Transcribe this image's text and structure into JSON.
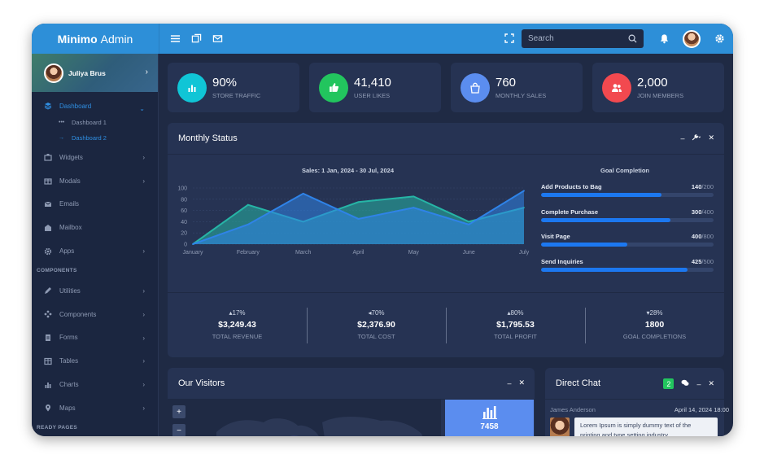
{
  "brand": {
    "bold": "Minimo",
    "rest": "Admin"
  },
  "search": {
    "placeholder": "Search"
  },
  "sidebar": {
    "user_name": "Juliya Brus",
    "items": [
      {
        "label": "Dashboard",
        "icon": "layers-icon"
      },
      {
        "label": "Widgets",
        "icon": "widgets-icon"
      },
      {
        "label": "Modals",
        "icon": "gift-icon"
      },
      {
        "label": "Emails",
        "icon": "email-icon"
      },
      {
        "label": "Mailbox",
        "icon": "mailbox-icon"
      },
      {
        "label": "Apps",
        "icon": "gear-icon"
      },
      {
        "label": "Utilities",
        "icon": "pencil-icon"
      },
      {
        "label": "Components",
        "icon": "components-icon"
      },
      {
        "label": "Forms",
        "icon": "document-icon"
      },
      {
        "label": "Tables",
        "icon": "table-icon"
      },
      {
        "label": "Charts",
        "icon": "bar-chart-icon"
      },
      {
        "label": "Maps",
        "icon": "map-pin-icon"
      }
    ],
    "subitems": [
      {
        "label": "Dashboard 1"
      },
      {
        "label": "Dashboard 2"
      }
    ],
    "sections": [
      "COMPONENTS",
      "READY PAGES"
    ]
  },
  "stats": [
    {
      "value": "90%",
      "label": "STORE TRAFFIC",
      "color": "#10c5d6",
      "icon": "bar-chart-icon"
    },
    {
      "value": "41,410",
      "label": "USER LIKES",
      "color": "#22c55e",
      "icon": "thumbs-up-icon"
    },
    {
      "value": "760",
      "label": "MONTHLY SALES",
      "color": "#5b8def",
      "icon": "shopping-bag-icon"
    },
    {
      "value": "2,000",
      "label": "JOIN MEMBERS",
      "color": "#f2494f",
      "icon": "users-icon"
    }
  ],
  "monthly_status": {
    "title": "Monthly Status",
    "goal_title": "Goal Completion",
    "goals": [
      {
        "label": "Add Products to Bag",
        "current": "140",
        "total": "/200",
        "fraction": 0.7
      },
      {
        "label": "Complete Purchase",
        "current": "300",
        "total": "/400",
        "fraction": 0.75
      },
      {
        "label": "Visit Page",
        "current": "400",
        "total": "/800",
        "fraction": 0.5
      },
      {
        "label": "Send Inquiries",
        "current": "425",
        "total": "/500",
        "fraction": 0.85
      }
    ],
    "summary": [
      {
        "pct": "17%",
        "dir": "up",
        "amount": "$3,249.43",
        "label": "TOTAL REVENUE"
      },
      {
        "pct": "70%",
        "dir": "left",
        "amount": "$2,376.90",
        "label": "TOTAL COST"
      },
      {
        "pct": "80%",
        "dir": "up",
        "amount": "$1,795.53",
        "label": "TOTAL PROFIT"
      },
      {
        "pct": "28%",
        "dir": "down",
        "amount": "1800",
        "label": "GOAL COMPLETIONS"
      }
    ]
  },
  "chart_data": {
    "type": "area",
    "title": "Sales: 1 Jan, 2024 - 30 Jul, 2024",
    "categories": [
      "January",
      "February",
      "March",
      "April",
      "May",
      "June",
      "July"
    ],
    "ylim": [
      0,
      100
    ],
    "yticks": [
      0,
      20,
      40,
      60,
      80,
      100
    ],
    "grid": true,
    "series": [
      {
        "values": [
          0,
          70,
          40,
          75,
          85,
          40,
          65
        ],
        "color": "#26b5a6"
      },
      {
        "values": [
          0,
          35,
          90,
          45,
          65,
          35,
          95
        ],
        "color": "#2f83e8"
      }
    ]
  },
  "visitors": {
    "title": "Our Visitors",
    "count": "7458",
    "zoom_in": "+",
    "zoom_out": "−"
  },
  "chat": {
    "title": "Direct Chat",
    "badge": "2",
    "author": "James Anderson",
    "time": "April 14, 2024 18:00",
    "message": "Lorem Ipsum is simply dummy text of the printing and type setting industry."
  }
}
